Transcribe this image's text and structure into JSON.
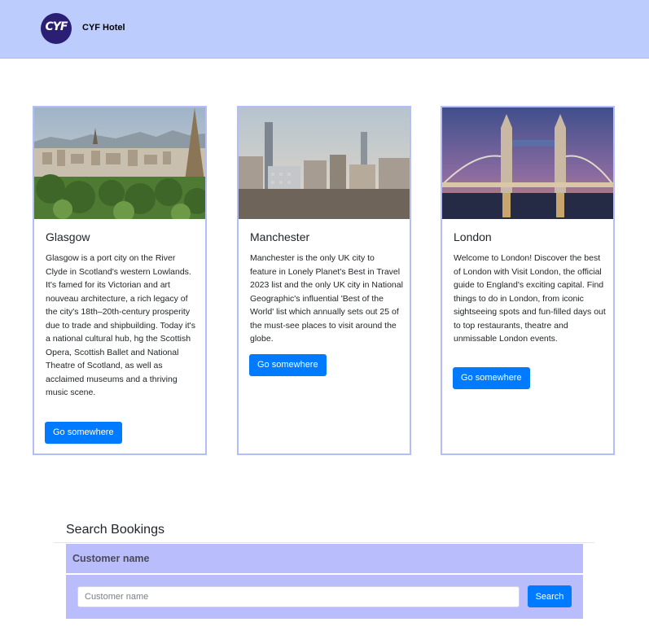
{
  "header": {
    "logo_text": "CYF",
    "brand": "CYF Hotel",
    "colors": {
      "background": "#bccdfd",
      "logo": "#2a1f74"
    }
  },
  "cards": [
    {
      "title": "Glasgow",
      "text": "Glasgow is a port city on the River Clyde in Scotland's western Lowlands. It's famed for its Victorian and art nouveau architecture, a rich legacy of the city's 18th–20th-century prosperity due to trade and shipbuilding. Today it's a national cultural hub, hg the Scottish Opera, Scottish Ballet and National Theatre of Scotland, as well as acclaimed museums and a thriving music scene.",
      "button": "Go somewhere"
    },
    {
      "title": "Manchester",
      "text": "Manchester is the only UK city to feature in Lonely Planet's Best in Travel 2023 list and the only UK city in National Geographic's influential 'Best of the World' list which annually sets out 25 of the must-see places to visit around the globe.",
      "button": "Go somewhere"
    },
    {
      "title": "London",
      "text": "Welcome to London! Discover the best of London with Visit London, the official guide to England's exciting capital. Find things to do in London, from iconic sightseeing spots and fun-filled days out to top restaurants, theatre and unmissable London events.",
      "button": "Go somewhere"
    }
  ],
  "search": {
    "title": "Search Bookings",
    "label": "Customer name",
    "placeholder": "Customer name",
    "value": "",
    "button": "Search",
    "colors": {
      "panel": "#babdfc",
      "button": "#007bff"
    }
  }
}
